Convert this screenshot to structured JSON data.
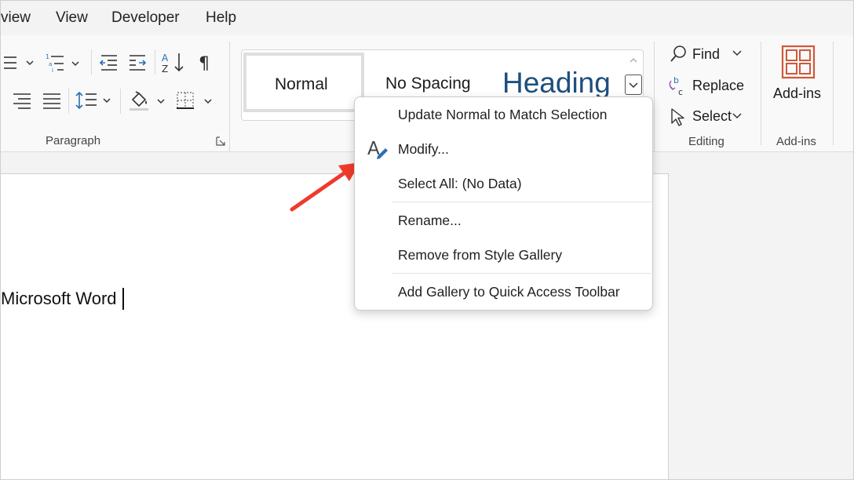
{
  "menu_tabs": [
    {
      "label": "view"
    },
    {
      "label": "View"
    },
    {
      "label": "Developer"
    },
    {
      "label": "Help"
    }
  ],
  "ribbon": {
    "paragraph_group": {
      "label": "Paragraph"
    },
    "styles": {
      "items": [
        {
          "label": "Normal"
        },
        {
          "label": "No Spacing"
        },
        {
          "label": "Heading"
        }
      ]
    },
    "editing_group": {
      "label": "Editing",
      "find_label": "Find",
      "replace_label": "Replace",
      "select_label": "Select"
    },
    "addins_group": {
      "label": "Add-ins",
      "button_label": "Add-ins"
    }
  },
  "context_menu": {
    "items": [
      {
        "label": "Update Normal to Match Selection"
      },
      {
        "label": "Modify..."
      },
      {
        "label": "Select All: (No Data)"
      },
      {
        "label": "Rename..."
      },
      {
        "label": "Remove from Style Gallery"
      },
      {
        "label": "Add Gallery to Quick Access Toolbar"
      }
    ]
  },
  "document": {
    "text": "Microsoft Word"
  },
  "colors": {
    "accent_orange": "#d0583a",
    "arrow_red": "#ef3a2c",
    "heading_blue": "#1d4f7d",
    "icon_blue": "#2a6fb5"
  }
}
